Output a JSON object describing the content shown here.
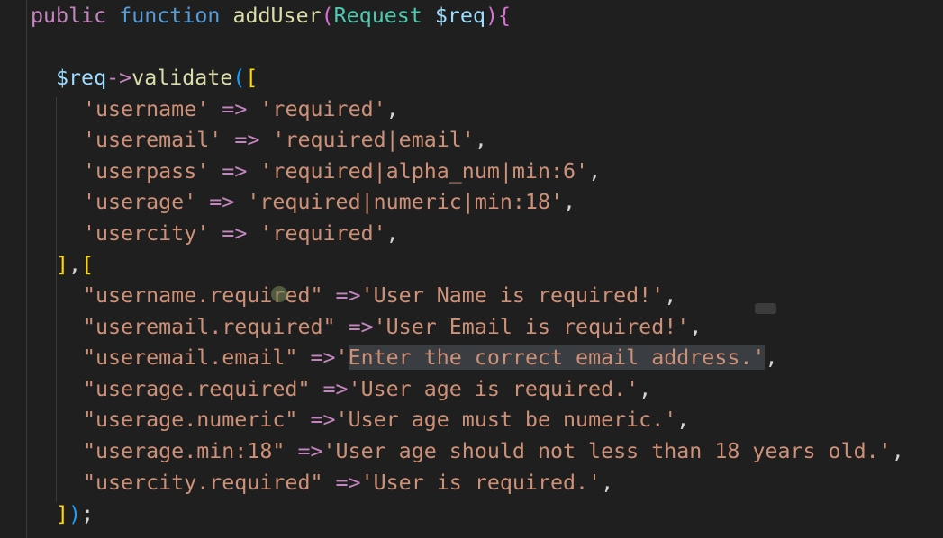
{
  "code": {
    "line1": {
      "public": "public",
      "function": "function",
      "name": "addUser",
      "paren_open": "(",
      "type": "Request",
      "param": "$req",
      "paren_close": ")",
      "brace": "{"
    },
    "line2": {
      "var": "$req",
      "arrow": "->",
      "method": "validate",
      "paren": "(",
      "bracket": "["
    },
    "rules": [
      {
        "key": "'username'",
        "arrow": "=>",
        "value": "'required'",
        "end": ","
      },
      {
        "key": "'useremail'",
        "arrow": "=>",
        "value": "'required|email'",
        "end": ","
      },
      {
        "key": "'userpass'",
        "arrow": "=>",
        "value": "'required|alpha_num|min:6'",
        "end": ","
      },
      {
        "key": "'userage'",
        "arrow": "=>",
        "value": "'required|numeric|min:18'",
        "end": ","
      },
      {
        "key": "'usercity'",
        "arrow": "=>",
        "value": "'required'",
        "end": ","
      }
    ],
    "separator": {
      "close": "]",
      "comma": ",",
      "open": "["
    },
    "messages": [
      {
        "key": "\"username.required\"",
        "arrow": "=>",
        "value": "'User Name is required!'",
        "end": ","
      },
      {
        "key": "\"useremail.required\"",
        "arrow": "=>",
        "value": "'User Email is required!'",
        "end": ","
      },
      {
        "key": "\"useremail.email\"",
        "arrow": "=>",
        "quote_open": "'",
        "value": "Enter the correct email address.'",
        "end": ","
      },
      {
        "key": "\"userage.required\"",
        "arrow": "=>",
        "value": "'User age is required.'",
        "end": ","
      },
      {
        "key": "\"userage.numeric\"",
        "arrow": "=>",
        "value": "'User age must be numeric.'",
        "end": ","
      },
      {
        "key": "\"userage.min:18\"",
        "arrow": "=>",
        "value": "'User age should not less than 18 years old.'",
        "end": ","
      },
      {
        "key": "\"usercity.required\"",
        "arrow": "=>",
        "value": "'User is required.'",
        "end": ","
      }
    ],
    "closing": {
      "bracket": "]",
      "paren": ")",
      "semi": ";"
    }
  },
  "colors": {
    "background": "#1f1f1f",
    "keyword": "#c586c0",
    "function_keyword": "#569cd6",
    "function_name": "#dcdcaa",
    "variable": "#9cdcfe",
    "class": "#4ec9b0",
    "string": "#ce9178",
    "selection": "#3a3d41"
  }
}
